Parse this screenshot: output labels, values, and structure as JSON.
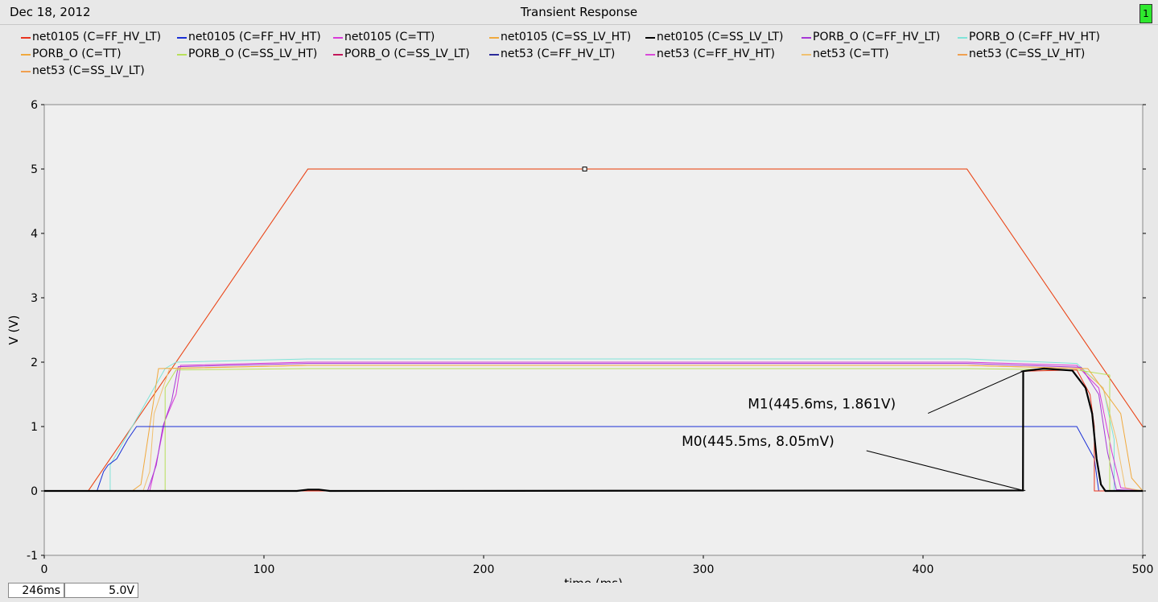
{
  "header": {
    "date": "Dec 18, 2012",
    "title": "Transient Response",
    "badge": "1"
  },
  "legend": [
    {
      "label": "net0105 (C=FF_HV_LT)",
      "color": "#e8331e"
    },
    {
      "label": "net0105 (C=FF_HV_HT)",
      "color": "#1a2fd6"
    },
    {
      "label": "net0105 (C=TT)",
      "color": "#d93ad9"
    },
    {
      "label": "net0105 (C=SS_LV_HT)",
      "color": "#f0a93e"
    },
    {
      "label": "net0105 (C=SS_LV_LT)",
      "color": "#000000"
    },
    {
      "label": "PORB_O (C=FF_HV_LT)",
      "color": "#a638d6"
    },
    {
      "label": "PORB_O (C=FF_HV_HT)",
      "color": "#7fe3d8"
    },
    {
      "label": "PORB_O (C=TT)",
      "color": "#f0a93e"
    },
    {
      "label": "PORB_O (C=SS_LV_HT)",
      "color": "#b8e05a"
    },
    {
      "label": "PORB_O (C=SS_LV_LT)",
      "color": "#c2185b"
    },
    {
      "label": "net53 (C=FF_HV_LT)",
      "color": "#2b2b9a"
    },
    {
      "label": "net53 (C=FF_HV_HT)",
      "color": "#d94ad9"
    },
    {
      "label": "net53 (C=TT)",
      "color": "#f0c070"
    },
    {
      "label": "net53 (C=SS_LV_HT)",
      "color": "#f0a050"
    },
    {
      "label": "net53 (C=SS_LV_LT)",
      "color": "#f0a050"
    }
  ],
  "status": {
    "x_value": "246ms",
    "y_value": "5.0V"
  },
  "chart_data": {
    "type": "line",
    "title": "Transient Response",
    "xlabel": "time (ms)",
    "ylabel": "V (V)",
    "xlim": [
      0,
      500
    ],
    "ylim": [
      -1,
      6
    ],
    "xticks": [
      0,
      100,
      200,
      300,
      400,
      500
    ],
    "yticks": [
      -1,
      0,
      1,
      2,
      3,
      4,
      5,
      6
    ],
    "grid": false,
    "legend_position": "top",
    "background": "#efefef",
    "series": [
      {
        "name": "net53 (C=SS_LV_HT)",
        "color": "#f0a050",
        "width": 1.2,
        "x": [
          0,
          20,
          120,
          420,
          500
        ],
        "y": [
          0,
          0,
          5,
          5,
          1.0
        ]
      },
      {
        "name": "net53 (C=FF_HV_LT)",
        "color": "#e8331e",
        "width": 0.8,
        "x": [
          0,
          20,
          120,
          420,
          500
        ],
        "y": [
          0,
          0,
          5,
          5,
          1.0
        ]
      },
      {
        "name": "PORB_O (C=FF_HV_HT)",
        "color": "#7fe3d8",
        "width": 1,
        "x": [
          0,
          30,
          30,
          55,
          60,
          120,
          420,
          470,
          482,
          487,
          487,
          500
        ],
        "y": [
          0,
          0,
          0.4,
          1.9,
          2.0,
          2.05,
          2.05,
          1.98,
          1.6,
          0.8,
          0,
          0
        ]
      },
      {
        "name": "net0105 (C=TT)",
        "color": "#d93ad9",
        "width": 1,
        "x": [
          0,
          48,
          52,
          55,
          60,
          62,
          120,
          420,
          470,
          480,
          486,
          490,
          500
        ],
        "y": [
          0,
          0,
          0.6,
          1.1,
          1.5,
          1.95,
          2.0,
          2.0,
          1.95,
          1.6,
          0.6,
          0.05,
          0
        ]
      },
      {
        "name": "PORB_O (C=FF_HV_LT)",
        "color": "#a638d6",
        "width": 1,
        "x": [
          0,
          47,
          51,
          54,
          58,
          61,
          120,
          420,
          472,
          480,
          484,
          488,
          500
        ],
        "y": [
          0,
          0,
          0.4,
          1.0,
          1.4,
          1.93,
          1.98,
          1.98,
          1.92,
          1.5,
          0.6,
          0.02,
          0
        ]
      },
      {
        "name": "net53 (C=TT)",
        "color": "#f0c070",
        "width": 1,
        "x": [
          0,
          45,
          48,
          50,
          55,
          57,
          120,
          420,
          472,
          482,
          488,
          492,
          500
        ],
        "y": [
          0,
          0,
          0.3,
          1.2,
          1.7,
          1.9,
          1.95,
          1.95,
          1.9,
          1.6,
          0.8,
          0.05,
          0
        ]
      },
      {
        "name": "PORB_O (C=SS_LV_HT)",
        "color": "#b8e05a",
        "width": 1,
        "x": [
          0,
          55,
          55,
          60,
          120,
          420,
          470,
          485,
          485,
          500
        ],
        "y": [
          0,
          0,
          1.6,
          1.88,
          1.9,
          1.9,
          1.88,
          1.8,
          0,
          0
        ]
      },
      {
        "name": "PORB_O (C=TT)",
        "color": "#f0a93e",
        "width": 1,
        "x": [
          0,
          40,
          44,
          48,
          52,
          120,
          420,
          475,
          490,
          495,
          500
        ],
        "y": [
          0,
          0,
          0.1,
          1.0,
          1.9,
          1.95,
          1.95,
          1.9,
          1.2,
          0.2,
          0
        ]
      },
      {
        "name": "net0105 (C=FF_HV_HT)",
        "color": "#1a2fd6",
        "width": 1,
        "x": [
          0,
          24,
          27,
          29,
          33,
          38,
          42,
          120,
          420,
          470,
          478,
          480,
          500
        ],
        "y": [
          0,
          0,
          0.3,
          0.4,
          0.5,
          0.8,
          1.0,
          1.0,
          1.0,
          1.0,
          0.5,
          0,
          0
        ]
      },
      {
        "name": "net0105 (C=FF_HV_LT)",
        "color": "#e8331e",
        "width": 1,
        "x": [
          0,
          445.5,
          445.5,
          470,
          476,
          478,
          478,
          500
        ],
        "y": [
          0,
          0,
          1.86,
          1.88,
          1.5,
          1.0,
          0,
          0
        ]
      },
      {
        "name": "net0105 (C=SS_LV_LT)",
        "color": "#000000",
        "width": 2.2,
        "x": [
          0,
          115,
          120,
          125,
          130,
          445.5,
          445.6,
          455,
          468,
          474,
          477,
          479,
          481,
          483,
          500
        ],
        "y": [
          0,
          0,
          0.02,
          0.02,
          0,
          0.008,
          1.86,
          1.9,
          1.87,
          1.6,
          1.2,
          0.5,
          0.1,
          0,
          0
        ]
      }
    ],
    "markers": [
      {
        "label": "M1(445.6ms, 1.861V)",
        "x": 445.6,
        "y": 1.861,
        "text_x": 340,
        "text_y": 1.28
      },
      {
        "label": "M0(445.5ms, 8.05mV)",
        "x": 445.5,
        "y": 0.00805,
        "text_x": 312,
        "text_y": 0.7
      }
    ],
    "cursor_point": {
      "x": 246,
      "y": 5.0
    }
  }
}
